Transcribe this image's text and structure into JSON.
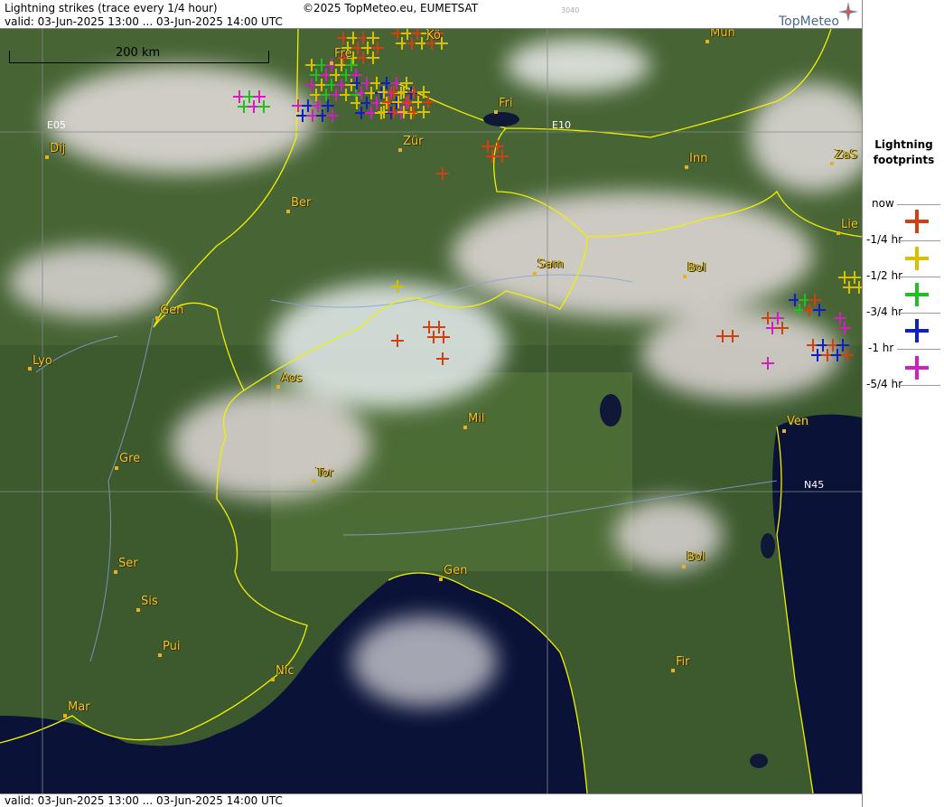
{
  "header": {
    "title": "Lightning strikes (trace every 1/4 hour)",
    "copyright": "©2025 TopMeteo.eu, EUMETSAT",
    "image_code": "3040",
    "valid": "valid:  03-Jun-2025 13:00 ... 03-Jun-2025 14:00 UTC",
    "logo": "TopMeteo"
  },
  "footer": {
    "valid": "valid:  03-Jun-2025 13:00 ... 03-Jun-2025 14:00 UTC"
  },
  "scale_bar": {
    "label": "200 km"
  },
  "grid_labels": {
    "e05": "E05",
    "e10": "E10",
    "n45": "N45"
  },
  "legend": {
    "title": "Lightning footprints",
    "rows": [
      {
        "label": "now",
        "color": "#d04010"
      },
      {
        "label": "-1/4 hr",
        "color": "#d8c000"
      },
      {
        "label": "-1/2 hr",
        "color": "#20c020"
      },
      {
        "label": "-3/4 hr",
        "color": "#1020c0"
      },
      {
        "label": "-1 hr",
        "color": "#d020c0"
      },
      {
        "label": "-5/4 hr",
        "color": ""
      }
    ]
  },
  "cities": [
    "Mun",
    "Dij",
    "Zür",
    "Fri",
    "Fre",
    "Inn",
    "ZaS",
    "Ber",
    "Lie",
    "Sam",
    "Bol",
    "Gen",
    "Lyo",
    "Aos",
    "Mil",
    "Ven",
    "Gre",
    "Tor",
    "Ser",
    "Gen",
    "Bol",
    "Sis",
    "Pui",
    "Nic",
    "Fir",
    "Mar",
    "Fri",
    "Kö"
  ],
  "colors": {
    "border": "#f0f000",
    "river": "#8aa0d8",
    "sea": "#0a1238",
    "land": "#3d5a2e"
  }
}
